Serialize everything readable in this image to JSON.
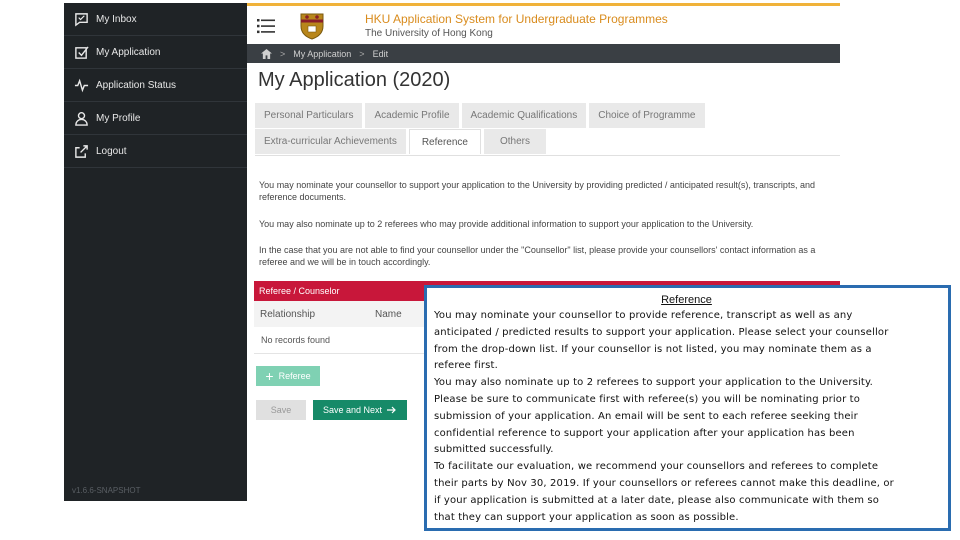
{
  "sidebar": {
    "items": [
      {
        "label": "My Inbox",
        "icon": "inbox-icon"
      },
      {
        "label": "My Application",
        "icon": "checkbox-icon"
      },
      {
        "label": "Application Status",
        "icon": "activity-icon"
      },
      {
        "label": "My Profile",
        "icon": "user-icon"
      },
      {
        "label": "Logout",
        "icon": "logout-icon"
      }
    ],
    "version": "v1.6.6-SNAPSHOT"
  },
  "header": {
    "app_title": "HKU Application System for Undergraduate Programmes",
    "university": "The University of Hong Kong"
  },
  "breadcrumb": {
    "items": [
      "My Application",
      "Edit"
    ]
  },
  "page": {
    "title": "My Application (2020)"
  },
  "tabs": {
    "row1": [
      "Personal Particulars",
      "Academic Profile",
      "Academic Qualifications",
      "Choice of Programme"
    ],
    "row2": [
      "Extra-curricular Achievements",
      "Reference",
      "Others"
    ],
    "active": "Reference"
  },
  "instructions": {
    "p1": "You may nominate your counsellor to support your application to the University by providing predicted / anticipated result(s), transcripts, and reference documents.",
    "p2": "You may also nominate up to 2 referees who may provide additional information to support your application to the University.",
    "p3": "In the case that you are not able to find your counsellor under the \"Counsellor\" list, please provide your counsellors' contact information as a referee and we will be in touch accordingly."
  },
  "referee_table": {
    "header": "Referee / Counselor",
    "columns": [
      "Relationship",
      "Name"
    ],
    "empty_text": "No records found"
  },
  "buttons": {
    "add_referee": "Referee",
    "save": "Save",
    "save_next": "Save and Next"
  },
  "callout": {
    "title": "Reference",
    "p1": "You may nominate your counsellor to support your application to the University by providing predicted / anticipated result(s), transcripts, and reference documents.",
    "lines1": [
      "You may nominate your counsellor to provide reference, transcript as well as any",
      "anticipated / predicted results to support your application. Please select your counsellor",
      "from the drop-down list. If your counsellor is not listed, you may nominate them as a",
      "referee first."
    ],
    "lines2": [
      "You may also nominate up to 2 referees to support your application to the University.",
      "Please be sure to communicate first with referee(s) you will be nominating prior to",
      "submission of your application.  An email will be sent to each referee seeking their",
      "confidential reference to support your application after your application has been",
      "submitted successfully."
    ],
    "lines3": [
      "To facilitate our evaluation, we recommend your counsellors and referees to complete",
      "their parts by Nov 30, 2019. If your counsellors or referees cannot make this deadline, or",
      "if your application is submitted at a later date, please also communicate with them so",
      "that they can support your application as soon as possible."
    ]
  },
  "colors": {
    "sidebar_bg": "#1f2326",
    "accent_gold": "#f0b23a",
    "referee_header": "#c8173a",
    "primary_button": "#168a68",
    "callout_border": "#2a6cb0"
  }
}
